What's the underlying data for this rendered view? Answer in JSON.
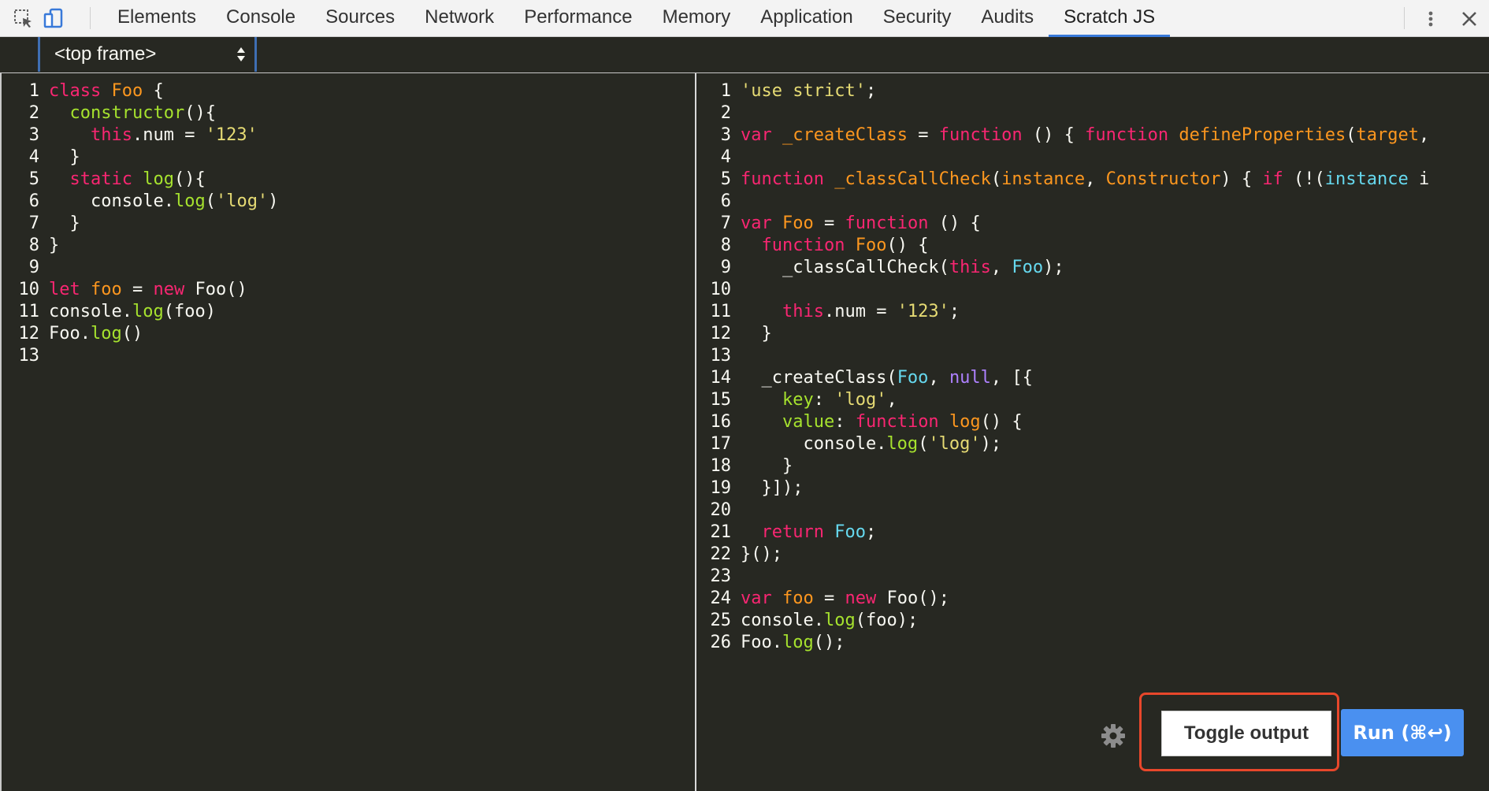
{
  "tabs": [
    {
      "label": "Elements",
      "active": false
    },
    {
      "label": "Console",
      "active": false
    },
    {
      "label": "Sources",
      "active": false
    },
    {
      "label": "Network",
      "active": false
    },
    {
      "label": "Performance",
      "active": false
    },
    {
      "label": "Memory",
      "active": false
    },
    {
      "label": "Application",
      "active": false
    },
    {
      "label": "Security",
      "active": false
    },
    {
      "label": "Audits",
      "active": false
    },
    {
      "label": "Scratch JS",
      "active": true
    }
  ],
  "frame_selector": {
    "value": "<top frame>"
  },
  "source_code": [
    [
      [
        "kw",
        "class"
      ],
      [
        "",
        "␣"
      ],
      [
        "nm",
        "Foo"
      ],
      [
        "",
        " {"
      ]
    ],
    [
      [
        "",
        "  "
      ],
      [
        "fn",
        "constructor"
      ],
      [
        "",
        "(){"
      ]
    ],
    [
      [
        "",
        "    "
      ],
      [
        "kw",
        "this"
      ],
      [
        "",
        ".num = "
      ],
      [
        "st",
        "'123'"
      ]
    ],
    [
      [
        "",
        "  }"
      ]
    ],
    [
      [
        "",
        "  "
      ],
      [
        "kw",
        "static"
      ],
      [
        "",
        "␣"
      ],
      [
        "fn",
        "log"
      ],
      [
        "",
        "(){"
      ]
    ],
    [
      [
        "",
        "    console."
      ],
      [
        "fn",
        "log"
      ],
      [
        "",
        "("
      ],
      [
        "st",
        "'log'"
      ],
      [
        "",
        ")"
      ]
    ],
    [
      [
        "",
        "  }"
      ]
    ],
    [
      [
        "",
        "}"
      ]
    ],
    [],
    [
      [
        "kw",
        "let"
      ],
      [
        "",
        "␣"
      ],
      [
        "nm",
        "foo"
      ],
      [
        "",
        " = "
      ],
      [
        "kw",
        "new"
      ],
      [
        "",
        "␣Foo()"
      ]
    ],
    [
      [
        "",
        "console."
      ],
      [
        "fn",
        "log"
      ],
      [
        "",
        "(foo)"
      ]
    ],
    [
      [
        "",
        "Foo."
      ],
      [
        "fn",
        "log"
      ],
      [
        "",
        "()"
      ]
    ],
    []
  ],
  "output_code": [
    [
      [
        "st",
        "'use strict'"
      ],
      [
        "",
        ";"
      ]
    ],
    [],
    [
      [
        "kw",
        "var"
      ],
      [
        "",
        "␣"
      ],
      [
        "nm",
        "_createClass"
      ],
      [
        "",
        " = "
      ],
      [
        "kw",
        "function"
      ],
      [
        "",
        " () { "
      ],
      [
        "kw",
        "function"
      ],
      [
        "",
        "␣"
      ],
      [
        "nm",
        "defineProperties"
      ],
      [
        "",
        "("
      ],
      [
        "nm",
        "target"
      ],
      [
        "",
        ","
      ]
    ],
    [],
    [
      [
        "kw",
        "function"
      ],
      [
        "",
        "␣"
      ],
      [
        "nm",
        "_classCallCheck"
      ],
      [
        "",
        "("
      ],
      [
        "nm",
        "instance"
      ],
      [
        "",
        ", "
      ],
      [
        "nm",
        "Constructor"
      ],
      [
        "",
        ") { "
      ],
      [
        "kw",
        "if"
      ],
      [
        "",
        " (!("
      ],
      [
        "cl",
        "instance"
      ],
      [
        "",
        " i"
      ]
    ],
    [],
    [
      [
        "kw",
        "var"
      ],
      [
        "",
        "␣"
      ],
      [
        "nm",
        "Foo"
      ],
      [
        "",
        " = "
      ],
      [
        "kw",
        "function"
      ],
      [
        "",
        " () {"
      ]
    ],
    [
      [
        "",
        "  "
      ],
      [
        "kw",
        "function"
      ],
      [
        "",
        "␣"
      ],
      [
        "nm",
        "Foo"
      ],
      [
        "",
        "() {"
      ]
    ],
    [
      [
        "",
        "    _classCallCheck("
      ],
      [
        "kw",
        "this"
      ],
      [
        "",
        ", "
      ],
      [
        "cl",
        "Foo"
      ],
      [
        "",
        ");"
      ]
    ],
    [],
    [
      [
        "",
        "    "
      ],
      [
        "kw",
        "this"
      ],
      [
        "",
        ".num = "
      ],
      [
        "st",
        "'123'"
      ],
      [
        "",
        ";"
      ]
    ],
    [
      [
        "",
        "  }"
      ]
    ],
    [],
    [
      [
        "",
        "  _createClass("
      ],
      [
        "cl",
        "Foo"
      ],
      [
        "",
        ", "
      ],
      [
        "nu",
        "null"
      ],
      [
        "",
        ", [{"
      ]
    ],
    [
      [
        "",
        "    "
      ],
      [
        "fn",
        "key"
      ],
      [
        "",
        ": "
      ],
      [
        "st",
        "'log'"
      ],
      [
        "",
        ","
      ]
    ],
    [
      [
        "",
        "    "
      ],
      [
        "fn",
        "value"
      ],
      [
        "",
        ": "
      ],
      [
        "kw",
        "function"
      ],
      [
        "",
        "␣"
      ],
      [
        "nm",
        "log"
      ],
      [
        "",
        "() {"
      ]
    ],
    [
      [
        "",
        "      console."
      ],
      [
        "fn",
        "log"
      ],
      [
        "",
        "("
      ],
      [
        "st",
        "'log'"
      ],
      [
        "",
        ");"
      ]
    ],
    [
      [
        "",
        "    }"
      ]
    ],
    [
      [
        "",
        "  }]);"
      ]
    ],
    [],
    [
      [
        "",
        "  "
      ],
      [
        "kw",
        "return"
      ],
      [
        "",
        "␣"
      ],
      [
        "cl",
        "Foo"
      ],
      [
        "",
        ";"
      ]
    ],
    [
      [
        "",
        "}();"
      ]
    ],
    [],
    [
      [
        "kw",
        "var"
      ],
      [
        "",
        "␣"
      ],
      [
        "nm",
        "foo"
      ],
      [
        "",
        " = "
      ],
      [
        "kw",
        "new"
      ],
      [
        "",
        "␣Foo();"
      ]
    ],
    [
      [
        "",
        "console."
      ],
      [
        "fn",
        "log"
      ],
      [
        "",
        "(foo);"
      ]
    ],
    [
      [
        "",
        "Foo."
      ],
      [
        "fn",
        "log"
      ],
      [
        "",
        "();"
      ]
    ]
  ],
  "buttons": {
    "toggle_output": "Toggle output",
    "run": "Run (⌘↩)"
  },
  "icons": {
    "inspect": "inspect-element-icon",
    "device": "device-toolbar-icon",
    "more": "kebab-menu-icon",
    "close": "close-icon",
    "settings": "gear-icon"
  },
  "colors": {
    "editor_bg": "#272822",
    "keyword": "#f92672",
    "function": "#a6e22e",
    "string": "#e6db74",
    "name": "#fd971f",
    "class_ref": "#66d9ef",
    "number_literal": "#ae81ff",
    "run_button": "#4a90f0",
    "highlight_box": "#e8472b",
    "active_tab": "#3879d9"
  }
}
